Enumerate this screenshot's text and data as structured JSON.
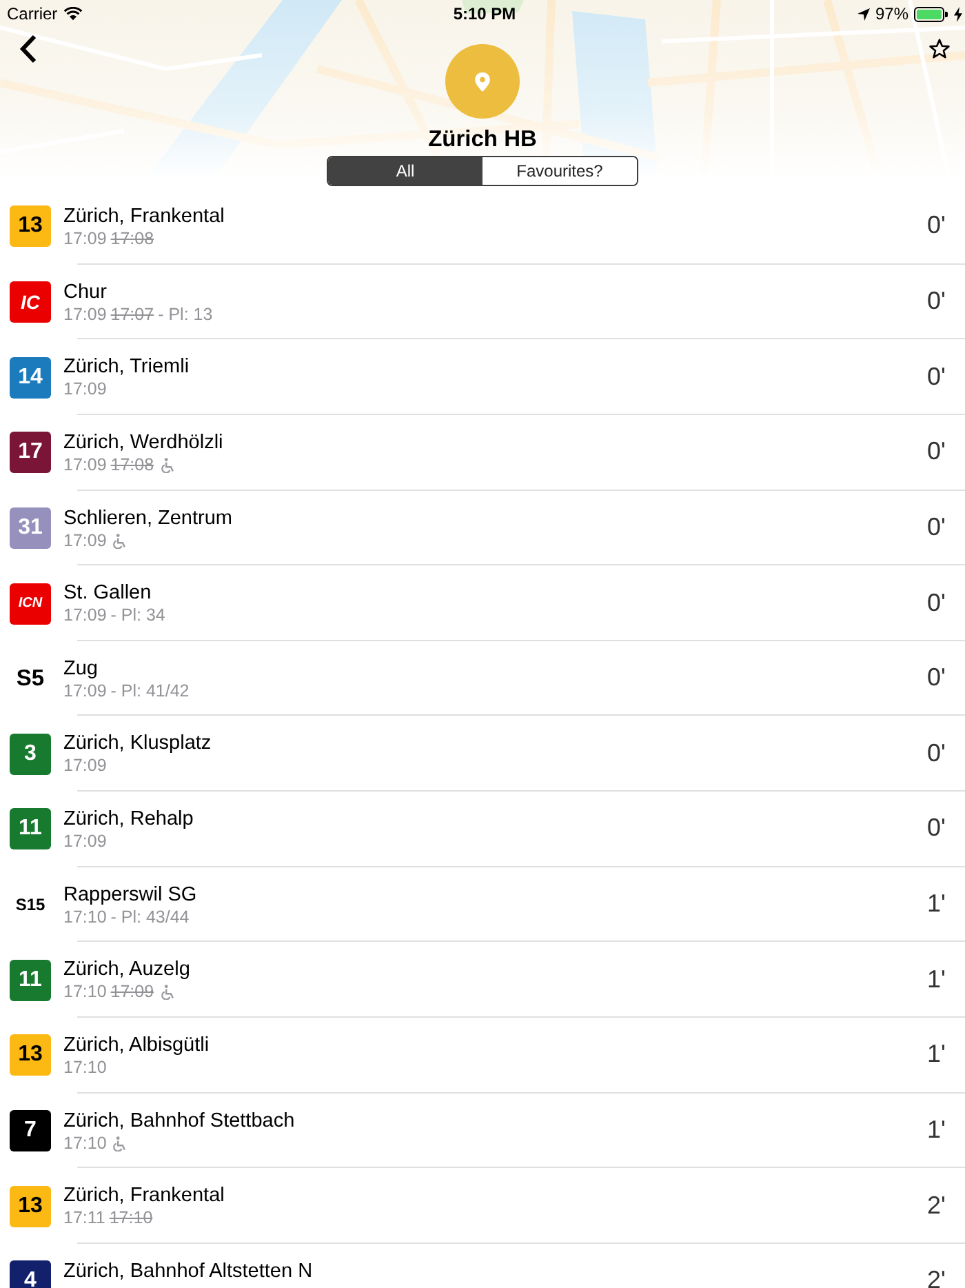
{
  "status_bar": {
    "carrier": "Carrier",
    "time": "5:10 PM",
    "battery": "97%"
  },
  "header": {
    "title": "Zürich HB",
    "starred": false
  },
  "tabs": [
    {
      "label": "All",
      "selected": true
    },
    {
      "label": "Favourites?",
      "selected": false
    }
  ],
  "departures": [
    {
      "line": "13",
      "kind": "line",
      "color": "#fdb913",
      "destination": "Zürich, Frankental",
      "time": "17:09",
      "scheduled": "17:08",
      "accessible": false,
      "minutes": "0'"
    },
    {
      "line": "IC",
      "kind": "logo",
      "color": "#eb0000",
      "destination": "Chur",
      "time": "17:09",
      "scheduled": "17:07",
      "platform": "- Pl: 13",
      "accessible": false,
      "minutes": "0'"
    },
    {
      "line": "14",
      "kind": "line",
      "color": "#1b7bbd",
      "destination": "Zürich, Triemli",
      "time": "17:09",
      "accessible": false,
      "minutes": "0'"
    },
    {
      "line": "17",
      "kind": "line",
      "color": "#7a1538",
      "destination": "Zürich, Werdhölzli",
      "time": "17:09",
      "scheduled": "17:08",
      "accessible": true,
      "minutes": "0'"
    },
    {
      "line": "31",
      "kind": "line",
      "color": "#9690bd",
      "destination": "Schlieren, Zentrum",
      "time": "17:09",
      "accessible": true,
      "minutes": "0'"
    },
    {
      "line": "ICN",
      "kind": "logo",
      "color": "#eb0000",
      "destination": "St. Gallen",
      "time": "17:09",
      "platform": "- Pl: 34",
      "accessible": false,
      "minutes": "0'"
    },
    {
      "line": "S5",
      "kind": "plain",
      "destination": "Zug",
      "time": "17:09",
      "platform": "- Pl: 41/42",
      "accessible": false,
      "minutes": "0'"
    },
    {
      "line": "3",
      "kind": "line",
      "color": "#177a2f",
      "destination": "Zürich, Klusplatz",
      "time": "17:09",
      "accessible": false,
      "minutes": "0'"
    },
    {
      "line": "11",
      "kind": "line",
      "color": "#177a2f",
      "destination": "Zürich, Rehalp",
      "time": "17:09",
      "accessible": false,
      "minutes": "0'"
    },
    {
      "line": "S15",
      "kind": "plain",
      "destination": "Rapperswil SG",
      "time": "17:10",
      "platform": "- Pl: 43/44",
      "accessible": false,
      "minutes": "1'"
    },
    {
      "line": "11",
      "kind": "line",
      "color": "#177a2f",
      "destination": "Zürich, Auzelg",
      "time": "17:10",
      "scheduled": "17:09",
      "accessible": true,
      "minutes": "1'"
    },
    {
      "line": "13",
      "kind": "line",
      "color": "#fdb913",
      "destination": "Zürich, Albisgütli",
      "time": "17:10",
      "accessible": false,
      "minutes": "1'"
    },
    {
      "line": "7",
      "kind": "line",
      "color": "#000000",
      "destination": "Zürich, Bahnhof Stettbach",
      "time": "17:10",
      "accessible": true,
      "minutes": "1'"
    },
    {
      "line": "13",
      "kind": "line",
      "color": "#fdb913",
      "destination": "Zürich, Frankental",
      "time": "17:11",
      "scheduled": "17:10",
      "accessible": false,
      "minutes": "2'"
    },
    {
      "line": "4",
      "kind": "line",
      "color": "#13206b",
      "destination": "Zürich, Bahnhof Altstetten N",
      "minutes": "2'"
    }
  ]
}
